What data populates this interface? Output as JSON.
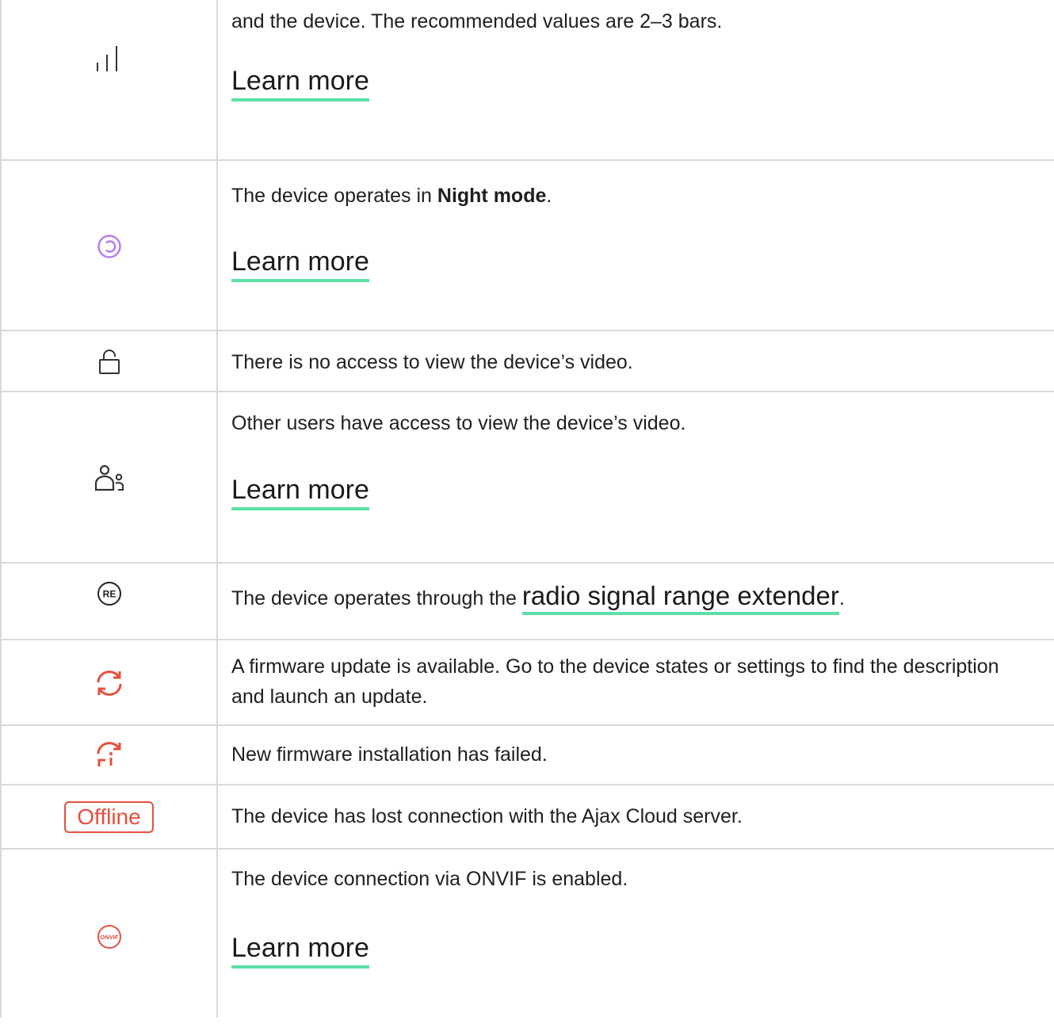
{
  "rows": [
    {
      "icon": "signal-bars-icon",
      "text": "and the device. The recommended values are 2–3 bars.",
      "link": "Learn more"
    },
    {
      "icon": "night-mode-icon",
      "text_before": "The device operates in ",
      "text_bold": "Night mode",
      "text_after": ".",
      "link": "Learn more"
    },
    {
      "icon": "lock-icon",
      "text": "There is no access to view the device’s video."
    },
    {
      "icon": "shared-users-icon",
      "text": "Other users have access to view the device’s video.",
      "link": "Learn more"
    },
    {
      "icon": "re-icon",
      "icon_label": "RE",
      "text_before": "The device operates through the ",
      "link": "radio signal range extender",
      "text_after": "."
    },
    {
      "icon": "firmware-update-icon",
      "text": "A firmware update is available. Go to the device states or settings to find the description and launch an update."
    },
    {
      "icon": "firmware-failed-icon",
      "text": "New firmware installation has failed."
    },
    {
      "icon": "offline-badge",
      "badge": "Offline",
      "text": "The device has lost connection with the Ajax Cloud server."
    },
    {
      "icon": "onvif-icon",
      "icon_label": "ONVIF",
      "text": "The device connection via ONVIF is enabled.",
      "link": "Learn more"
    }
  ],
  "colors": {
    "accent_green": "#5ce0a6",
    "night_purple": "#b57ef0",
    "alert_red": "#e4503d",
    "border": "#d9d9d9"
  }
}
